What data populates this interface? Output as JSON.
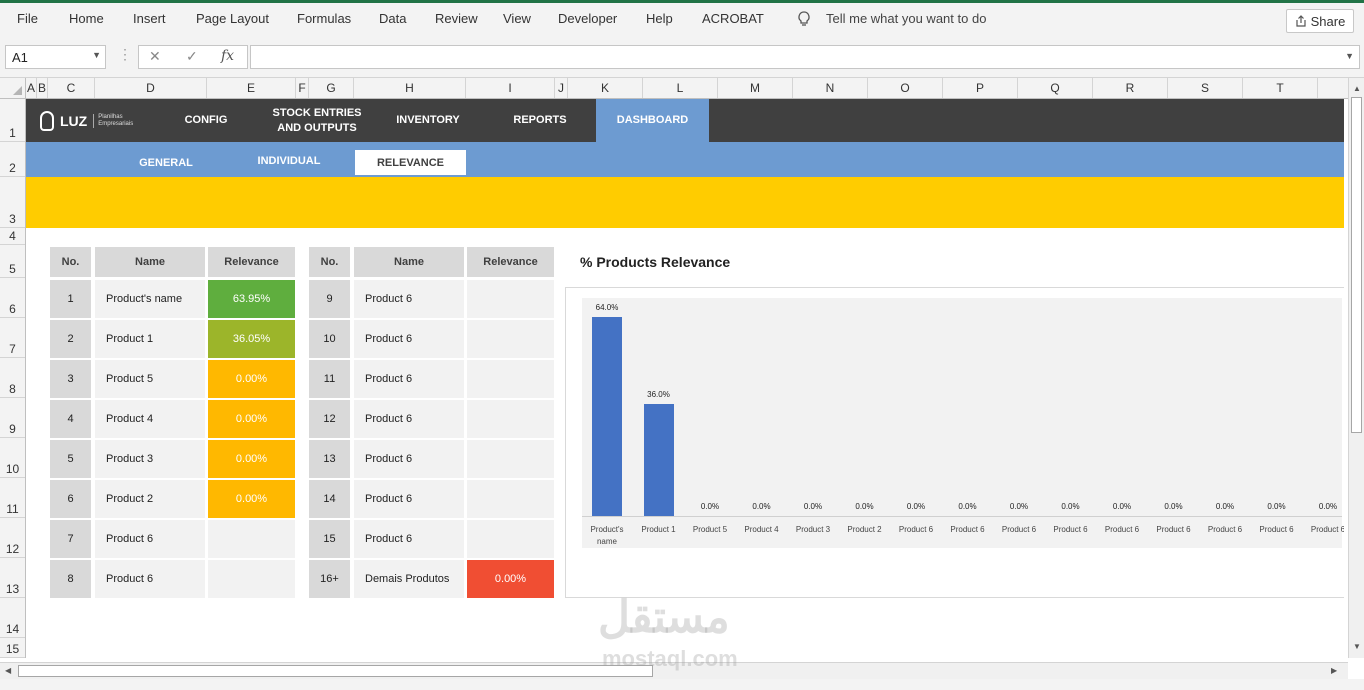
{
  "ribbon": {
    "menus": [
      "File",
      "Home",
      "Insert",
      "Page Layout",
      "Formulas",
      "Data",
      "Review",
      "View",
      "Developer",
      "Help",
      "ACROBAT"
    ],
    "tell_me": "Tell me what you want to do",
    "share": "Share"
  },
  "formula_bar": {
    "name_box": "A1",
    "fx": "fx",
    "value": ""
  },
  "columns": [
    "A",
    "B",
    "C",
    "D",
    "E",
    "F",
    "G",
    "H",
    "I",
    "J",
    "K",
    "L",
    "M",
    "N",
    "O",
    "P",
    "Q",
    "R",
    "S",
    "T"
  ],
  "rows": [
    "1",
    "2",
    "3",
    "4",
    "5",
    "6",
    "7",
    "8",
    "9",
    "10",
    "11",
    "12",
    "13",
    "14",
    "15"
  ],
  "logo": {
    "brand": "LUZ",
    "sub": "Planilhas Empresariais"
  },
  "nav": {
    "items": [
      "CONFIG",
      "STOCK ENTRIES AND OUTPUTS",
      "INVENTORY",
      "REPORTS",
      "DASHBOARD"
    ],
    "active": "DASHBOARD"
  },
  "subnav": {
    "items": [
      "GENERAL",
      "INDIVIDUAL",
      "RELEVANCE"
    ],
    "active": "RELEVANCE"
  },
  "table_headers": {
    "no": "No.",
    "name": "Name",
    "relevance": "Relevance"
  },
  "left_table": [
    {
      "no": "1",
      "name": "Product's name",
      "relevance": "63.95%",
      "color": "#5fae3e"
    },
    {
      "no": "2",
      "name": "Product 1",
      "relevance": "36.05%",
      "color": "#9cb52a"
    },
    {
      "no": "3",
      "name": "Product 5",
      "relevance": "0.00%",
      "color": "#ffb800"
    },
    {
      "no": "4",
      "name": "Product 4",
      "relevance": "0.00%",
      "color": "#ffb800"
    },
    {
      "no": "5",
      "name": "Product 3",
      "relevance": "0.00%",
      "color": "#ffb800"
    },
    {
      "no": "6",
      "name": "Product 2",
      "relevance": "0.00%",
      "color": "#ffb800"
    },
    {
      "no": "7",
      "name": "Product 6",
      "relevance": "",
      "color": ""
    },
    {
      "no": "8",
      "name": "Product 6",
      "relevance": "",
      "color": ""
    }
  ],
  "right_table": [
    {
      "no": "9",
      "name": "Product 6",
      "relevance": "",
      "color": ""
    },
    {
      "no": "10",
      "name": "Product 6",
      "relevance": "",
      "color": ""
    },
    {
      "no": "11",
      "name": "Product 6",
      "relevance": "",
      "color": ""
    },
    {
      "no": "12",
      "name": "Product 6",
      "relevance": "",
      "color": ""
    },
    {
      "no": "13",
      "name": "Product 6",
      "relevance": "",
      "color": ""
    },
    {
      "no": "14",
      "name": "Product 6",
      "relevance": "",
      "color": ""
    },
    {
      "no": "15",
      "name": "Product 6",
      "relevance": "",
      "color": ""
    },
    {
      "no": "16+",
      "name": "Demais Produtos",
      "relevance": "0.00%",
      "color": "#f04e33"
    }
  ],
  "chart_data": {
    "type": "bar",
    "title": "% Products Relevance",
    "categories": [
      "Product's name",
      "Product 1",
      "Product 5",
      "Product 4",
      "Product 3",
      "Product 2",
      "Product 6",
      "Product 6",
      "Product 6",
      "Product 6",
      "Product 6",
      "Product 6",
      "Product 6",
      "Product 6",
      "Product 6"
    ],
    "values": [
      64.0,
      36.0,
      0.0,
      0.0,
      0.0,
      0.0,
      0.0,
      0.0,
      0.0,
      0.0,
      0.0,
      0.0,
      0.0,
      0.0,
      0.0
    ],
    "value_labels": [
      "64.0%",
      "36.0%",
      "0.0%",
      "0.0%",
      "0.0%",
      "0.0%",
      "0.0%",
      "0.0%",
      "0.0%",
      "0.0%",
      "0.0%",
      "0.0%",
      "0.0%",
      "0.0%",
      "0.0%"
    ],
    "ylim": [
      0,
      70
    ],
    "bar_color": "#4472c4"
  },
  "watermark": {
    "arabic": "مستقل",
    "latin": "mostaql.com"
  }
}
